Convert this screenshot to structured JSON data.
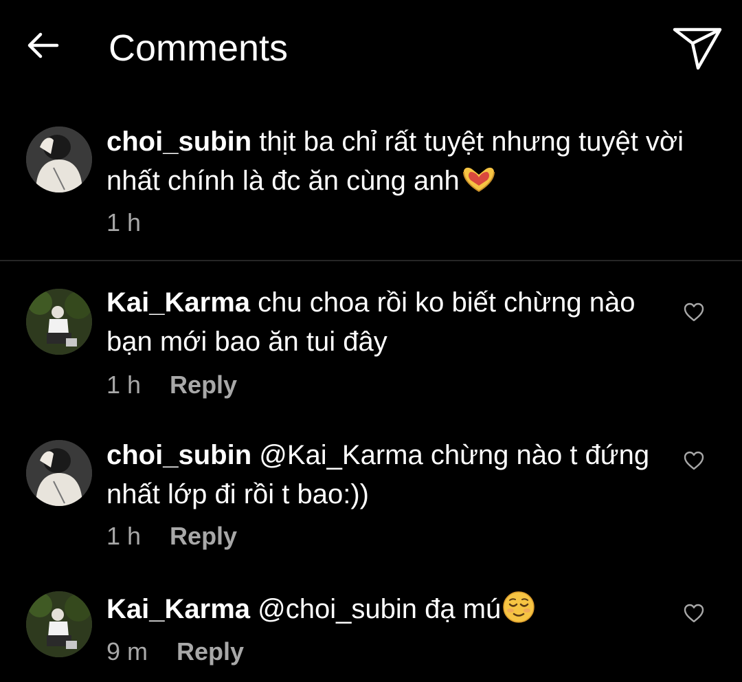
{
  "header": {
    "title": "Comments",
    "back_icon": "arrow-left-icon",
    "send_icon": "paper-plane-icon"
  },
  "caption": {
    "username": "choi_subin",
    "text": "thịt ba chỉ rất tuyệt nhưng tuyệt vời nhất chính là đc ăn cùng anh",
    "emoji": "heart-hands-emoji",
    "time": "1 h"
  },
  "comments": [
    {
      "username": "Kai_Karma",
      "text": "chu choa rồi ko biết chừng nào bạn mới bao ăn tui đây",
      "time": "1 h",
      "reply": "Reply"
    },
    {
      "username": "choi_subin",
      "text": "@Kai_Karma chừng nào t đứng nhất lớp đi rồi t bao:))",
      "time": "1 h",
      "reply": "Reply"
    },
    {
      "username": "Kai_Karma",
      "text": "@choi_subin đạ mú",
      "emoji": "relieved-face-emoji",
      "time": "9 m",
      "reply": "Reply"
    }
  ],
  "colors": {
    "background": "#000000",
    "text": "#ffffff",
    "muted": "#a8a8a8",
    "divider": "#262626"
  }
}
